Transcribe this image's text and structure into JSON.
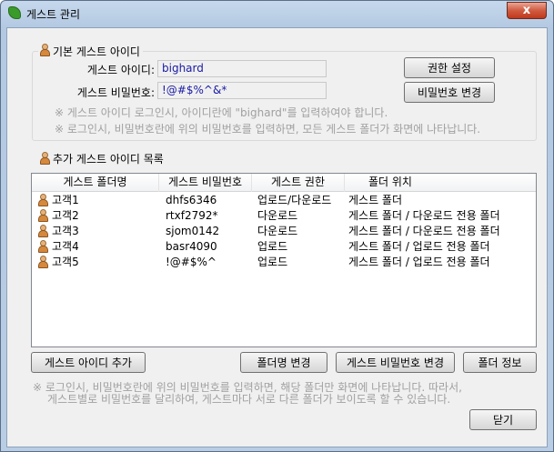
{
  "window": {
    "title": "게스트 관리",
    "close_glyph": "x"
  },
  "basic": {
    "title": "기본 게스트 아이디",
    "id_label": "게스트 아이디:",
    "id_value": "bighard",
    "pw_label": "게스트 비밀번호:",
    "pw_value": "!@#$%^&*",
    "perm_button": "권한 설정",
    "pw_button": "비밀번호 변경",
    "note1": "※ 게스트 아이디 로그인시, 아이디란에 \"bighard\"를 입력하여야 합니다.",
    "note2": "※ 로그인시, 비밀번호란에 위의 비밀번호를 입력하면, 모든 게스트 폴더가 화면에 나타납니다."
  },
  "extra": {
    "title": "추가 게스트 아이디 목록",
    "columns": [
      "게스트 폴더명",
      "게스트 비밀번호",
      "게스트 권한",
      "폴더 위치"
    ],
    "rows": [
      {
        "name": "고객1",
        "pw": "dhfs6346",
        "perm": "업로드/다운로드",
        "loc": "게스트 폴더"
      },
      {
        "name": "고객2",
        "pw": "rtxf2792*",
        "perm": "다운로드",
        "loc": "게스트 폴더 / 다운로드 전용 폴더"
      },
      {
        "name": "고객3",
        "pw": "sjom0142",
        "perm": "다운로드",
        "loc": "게스트 폴더 / 다운로드 전용 폴더"
      },
      {
        "name": "고객4",
        "pw": "basr4090",
        "perm": "업로드",
        "loc": "게스트 폴더 / 업로드 전용 폴더"
      },
      {
        "name": "고객5",
        "pw": "!@#$%^",
        "perm": "업로드",
        "loc": "게스트 폴더 / 업로드 전용 폴더"
      }
    ]
  },
  "buttons": {
    "add_guest": "게스트 아이디 추가",
    "rename_folder": "폴더명 변경",
    "change_guest_pw": "게스트 비밀번호 변경",
    "folder_info": "폴더 정보",
    "close": "닫기"
  },
  "bottom_note": {
    "line1": "※ 로그인시, 비밀번호란에 위의 비밀번호를 입력하면, 해당 폴더만 화면에 나타납니다. 따라서,",
    "line2": "게스트별로 비밀번호를 달리하여, 게스트마다 서로 다른 폴더가 보이도록 할 수 있습니다."
  }
}
